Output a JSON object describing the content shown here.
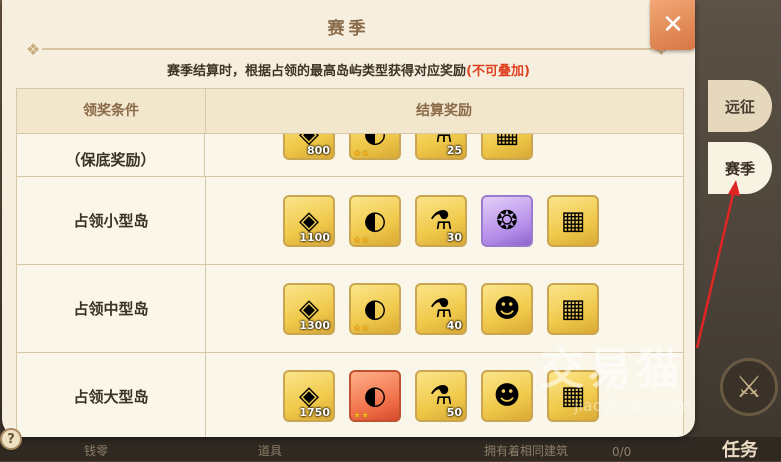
{
  "panel": {
    "title": "赛季",
    "subtitle_main": "赛季结算时，根据占领的最高岛屿类型获得对应奖励",
    "subtitle_highlight": "(不可叠加)"
  },
  "table": {
    "col_condition": "领奖条件",
    "col_reward": "结算奖励",
    "rows": [
      {
        "condition": "（保底奖励）",
        "items": [
          {
            "icon": "crystal-icon",
            "qty": "800",
            "style": "gold",
            "stars": ""
          },
          {
            "icon": "card-icon",
            "qty": "",
            "style": "gold",
            "stars": "★★"
          },
          {
            "icon": "potion-icon",
            "qty": "25",
            "style": "gold",
            "stars": ""
          },
          {
            "icon": "chest-icon",
            "qty": "",
            "style": "gold",
            "stars": ""
          }
        ]
      },
      {
        "condition": "占领小型岛",
        "items": [
          {
            "icon": "crystal-icon",
            "qty": "1100",
            "style": "gold",
            "stars": ""
          },
          {
            "icon": "card-icon",
            "qty": "",
            "style": "gold",
            "stars": "★★"
          },
          {
            "icon": "potion-icon",
            "qty": "30",
            "style": "gold",
            "stars": ""
          },
          {
            "icon": "spirit-icon",
            "qty": "",
            "style": "purple",
            "stars": ""
          },
          {
            "icon": "chest-icon",
            "qty": "",
            "style": "gold",
            "stars": ""
          }
        ]
      },
      {
        "condition": "占领中型岛",
        "items": [
          {
            "icon": "crystal-icon",
            "qty": "1300",
            "style": "gold",
            "stars": ""
          },
          {
            "icon": "card-icon",
            "qty": "",
            "style": "gold",
            "stars": "★★"
          },
          {
            "icon": "potion-icon",
            "qty": "40",
            "style": "gold",
            "stars": ""
          },
          {
            "icon": "ghost-icon",
            "qty": "",
            "style": "gold",
            "stars": ""
          },
          {
            "icon": "chest-icon",
            "qty": "",
            "style": "gold",
            "stars": ""
          }
        ]
      },
      {
        "condition": "占领大型岛",
        "items": [
          {
            "icon": "crystal-icon",
            "qty": "1750",
            "style": "gold",
            "stars": ""
          },
          {
            "icon": "card-icon",
            "qty": "",
            "style": "red",
            "stars": "★★"
          },
          {
            "icon": "potion-icon",
            "qty": "50",
            "style": "gold",
            "stars": ""
          },
          {
            "icon": "ghost-icon",
            "qty": "",
            "style": "gold",
            "stars": ""
          },
          {
            "icon": "chest-icon",
            "qty": "",
            "style": "gold",
            "stars": ""
          }
        ]
      }
    ]
  },
  "side_tabs": {
    "expedition": "远征",
    "season": "赛季"
  },
  "buttons": {
    "close": "✕",
    "help": "?",
    "task": "任务"
  },
  "watermark": {
    "main": "交易猫",
    "sub": "jiaoyimao.com"
  },
  "bottom_hints": [
    "钱零",
    "道具",
    "拥有着相同建筑",
    "0/0"
  ],
  "colors": {
    "accent_orange": "#d77645",
    "highlight_red": "#e04020",
    "title_brown": "#8a6a48"
  }
}
